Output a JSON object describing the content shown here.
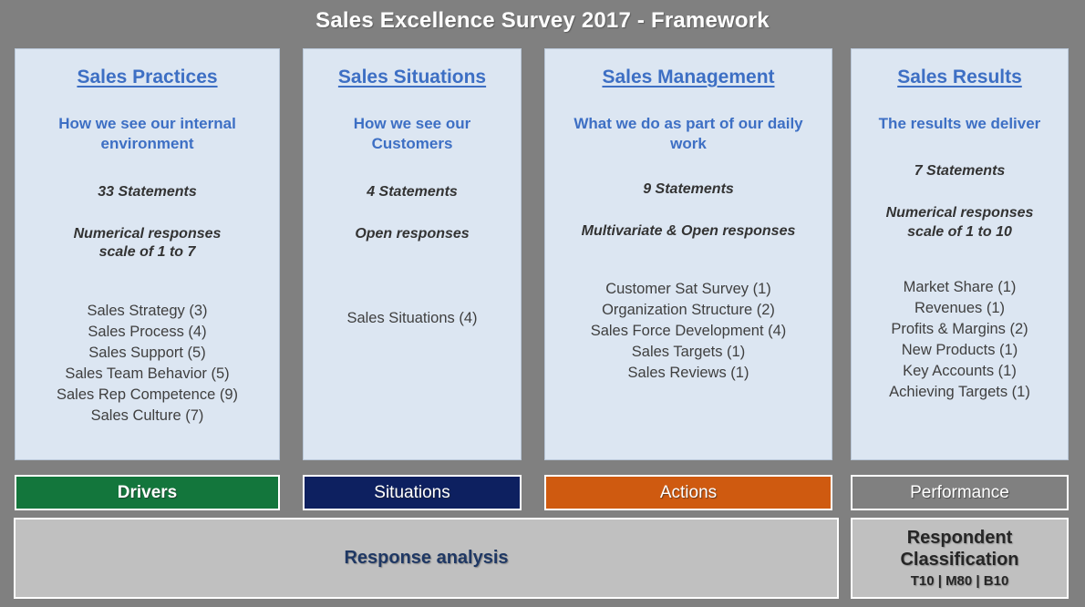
{
  "slide": {
    "title": "Sales Excellence Survey 2017 - Framework",
    "background_color": "#808080",
    "title_color": "#ffffff"
  },
  "columns": [
    {
      "heading": "Sales Practices",
      "subtitle": "How we see our  internal environment",
      "statements": "33 Statements",
      "response_type": "Numerical responses\nscale of 1 to 7",
      "items": [
        "Sales Strategy (3)",
        "Sales Process  (4)",
        "Sales Support (5)",
        "Sales Team Behavior (5)",
        "Sales Rep Competence (9)",
        "Sales Culture (7)"
      ],
      "band_label": "Drivers",
      "band_color": "#13763c",
      "band_bold": true
    },
    {
      "heading": "Sales Situations",
      "subtitle": "How we see our Customers",
      "statements": "4 Statements",
      "response_type": "Open responses",
      "items": [
        "Sales Situations (4)"
      ],
      "band_label": "Situations",
      "band_color": "#0d2060",
      "band_bold": false
    },
    {
      "heading": "Sales Management",
      "subtitle": "What  we do as part of our daily work",
      "statements": "9 Statements",
      "response_type": "Multivariate & Open responses",
      "items": [
        "Customer Sat Survey  (1)",
        "Organization Structure (2)",
        "Sales Force Development  (4)",
        "Sales Targets (1)",
        "Sales Reviews (1)"
      ],
      "band_label": "Actions",
      "band_color": "#cf5a10",
      "band_bold": false
    },
    {
      "heading": "Sales Results",
      "subtitle": "The results we deliver",
      "statements": "7 Statements",
      "response_type": "Numerical responses\nscale of 1 to 10",
      "items": [
        "Market Share (1)",
        "Revenues (1)",
        "Profits & Margins (2)",
        "New Products (1)",
        "Key Accounts (1)",
        "Achieving Targets (1)"
      ],
      "band_label": "Performance",
      "band_color": "#808080",
      "band_bold": false
    }
  ],
  "bottom": {
    "response_analysis_label": "Response analysis",
    "respondent_classification_title": "Respondent Classification",
    "respondent_classification_sub": "T10 | M80 | B10"
  },
  "colors": {
    "card_fill": "#dce6f2",
    "heading_blue": "#3d6fc4",
    "navy_text": "#1f3864",
    "gray_panel": "#c0c0c0"
  }
}
